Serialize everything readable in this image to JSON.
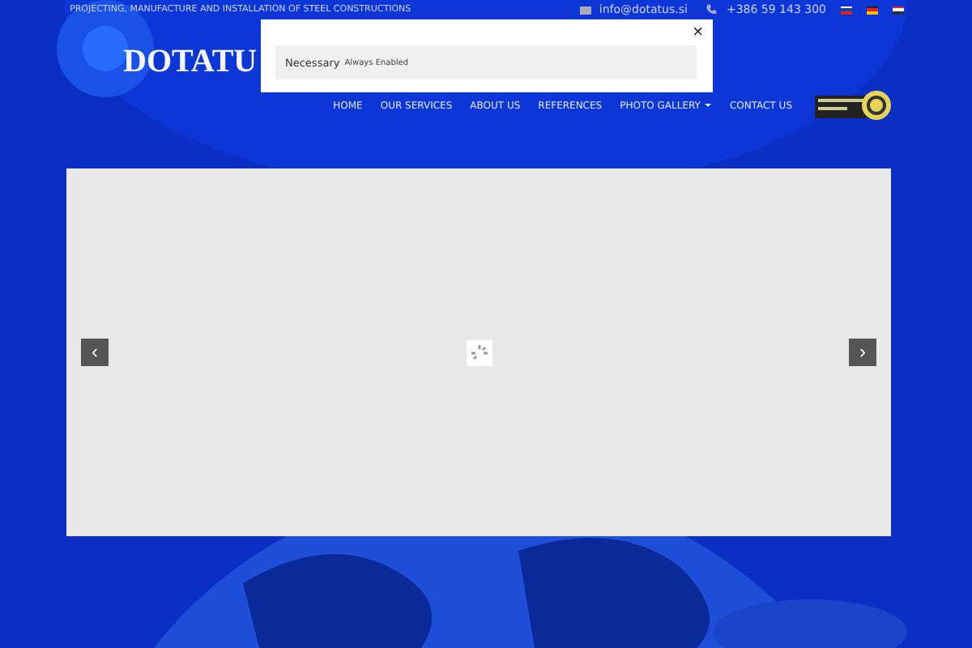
{
  "header": {
    "tagline": "PROJECTING, MANUFACTURE AND INSTALLATION OF STEEL CONSTRUCTIONS",
    "email": "info@dotatus.si",
    "phone": "+386 59 143 300",
    "logo": "DOTATU"
  },
  "nav": [
    {
      "label": "HOME",
      "has_submenu": false
    },
    {
      "label": "OUR SERVICES",
      "has_submenu": false
    },
    {
      "label": "ABOUT US",
      "has_submenu": false
    },
    {
      "label": "REFERENCES",
      "has_submenu": false
    },
    {
      "label": "PHOTO GALLERY",
      "has_submenu": true
    },
    {
      "label": "CONTACT US",
      "has_submenu": false
    }
  ],
  "cookie_popup": {
    "close": "×",
    "category": "Necessary",
    "status": "Always Enabled"
  },
  "slider": {
    "prev": "‹",
    "next": "›",
    "loading": true
  }
}
